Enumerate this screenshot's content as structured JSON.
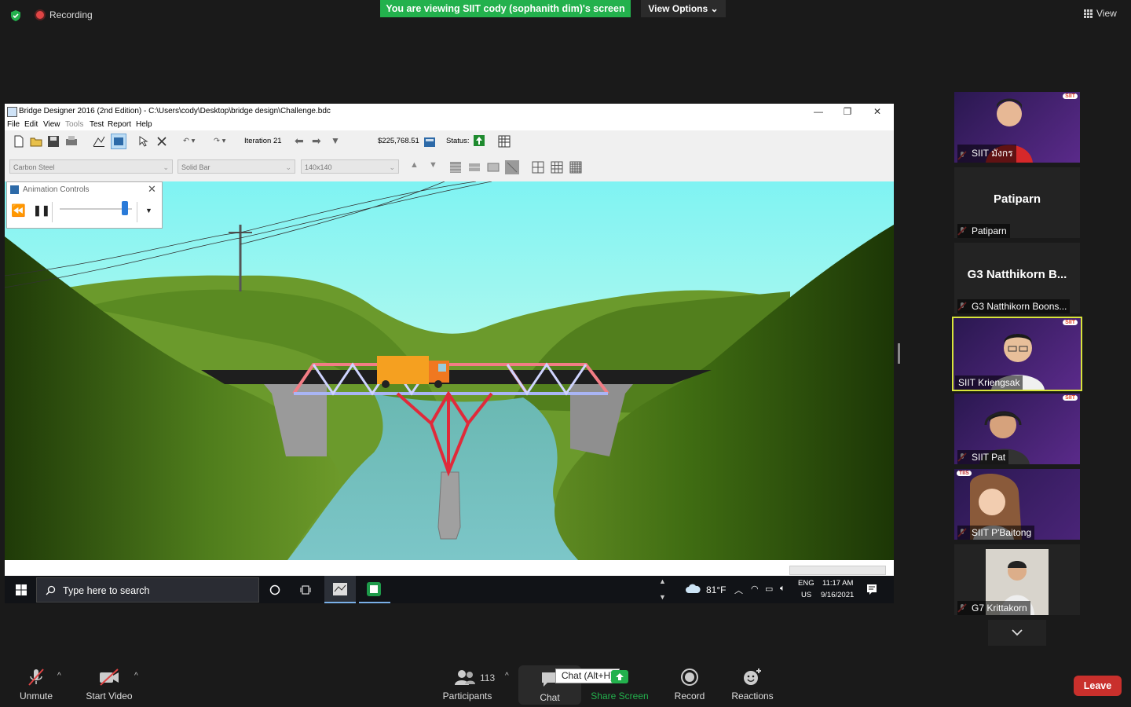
{
  "topbar": {
    "recording_label": "Recording",
    "viewing_banner": "You are viewing SIIT cody (sophanith dim)'s screen",
    "view_options_label": "View Options",
    "view_label": "View"
  },
  "app_window": {
    "title": "Bridge Designer 2016 (2nd Edition) - C:\\Users\\cody\\Desktop\\bridge design\\Challenge.bdc",
    "menu": [
      "File",
      "Edit",
      "View",
      "Tools",
      "Test",
      "Report",
      "Help"
    ],
    "iteration_label": "Iteration 21",
    "cost": "$225,768.51",
    "status_label": "Status:",
    "material_select": "Carbon Steel",
    "section_select": "Solid Bar",
    "size_select": "140x140",
    "animation_controls_title": "Animation Controls",
    "animation_speed_fraction": 0.9
  },
  "taskbar": {
    "search_placeholder": "Type here to search",
    "weather": "81°F",
    "lang_top": "ENG",
    "lang_bottom": "US",
    "time": "11:17 AM",
    "date": "9/16/2021"
  },
  "participants_panel": [
    {
      "name": "SIIT มังกร",
      "type": "video",
      "badge": "SIIT"
    },
    {
      "name": "Patiparn",
      "type": "name",
      "display": "Patiparn"
    },
    {
      "name": "G3 Natthikorn Boons...",
      "type": "name",
      "display": "G3 Natthikorn B..."
    },
    {
      "name": "SIIT Kriengsak",
      "type": "video",
      "badge": "SIIT",
      "active": true
    },
    {
      "name": "SIIT Pat",
      "type": "video",
      "badge": "SIIT"
    },
    {
      "name": "SIIT P'Baitong",
      "type": "video",
      "badge": "TIIS"
    },
    {
      "name": "G7 Krittakorn",
      "type": "video"
    }
  ],
  "controls": {
    "unmute": "Unmute",
    "start_video": "Start Video",
    "participants": "Participants",
    "participants_count": "113",
    "chat": "Chat",
    "chat_tooltip": "Chat (Alt+H)",
    "share_screen": "Share Screen",
    "record": "Record",
    "reactions": "Reactions",
    "leave": "Leave"
  },
  "colors": {
    "banner_green": "#23b14d",
    "leave_red": "#c9302c",
    "active_speaker": "#d8e43a",
    "share_green": "#23b14d"
  }
}
